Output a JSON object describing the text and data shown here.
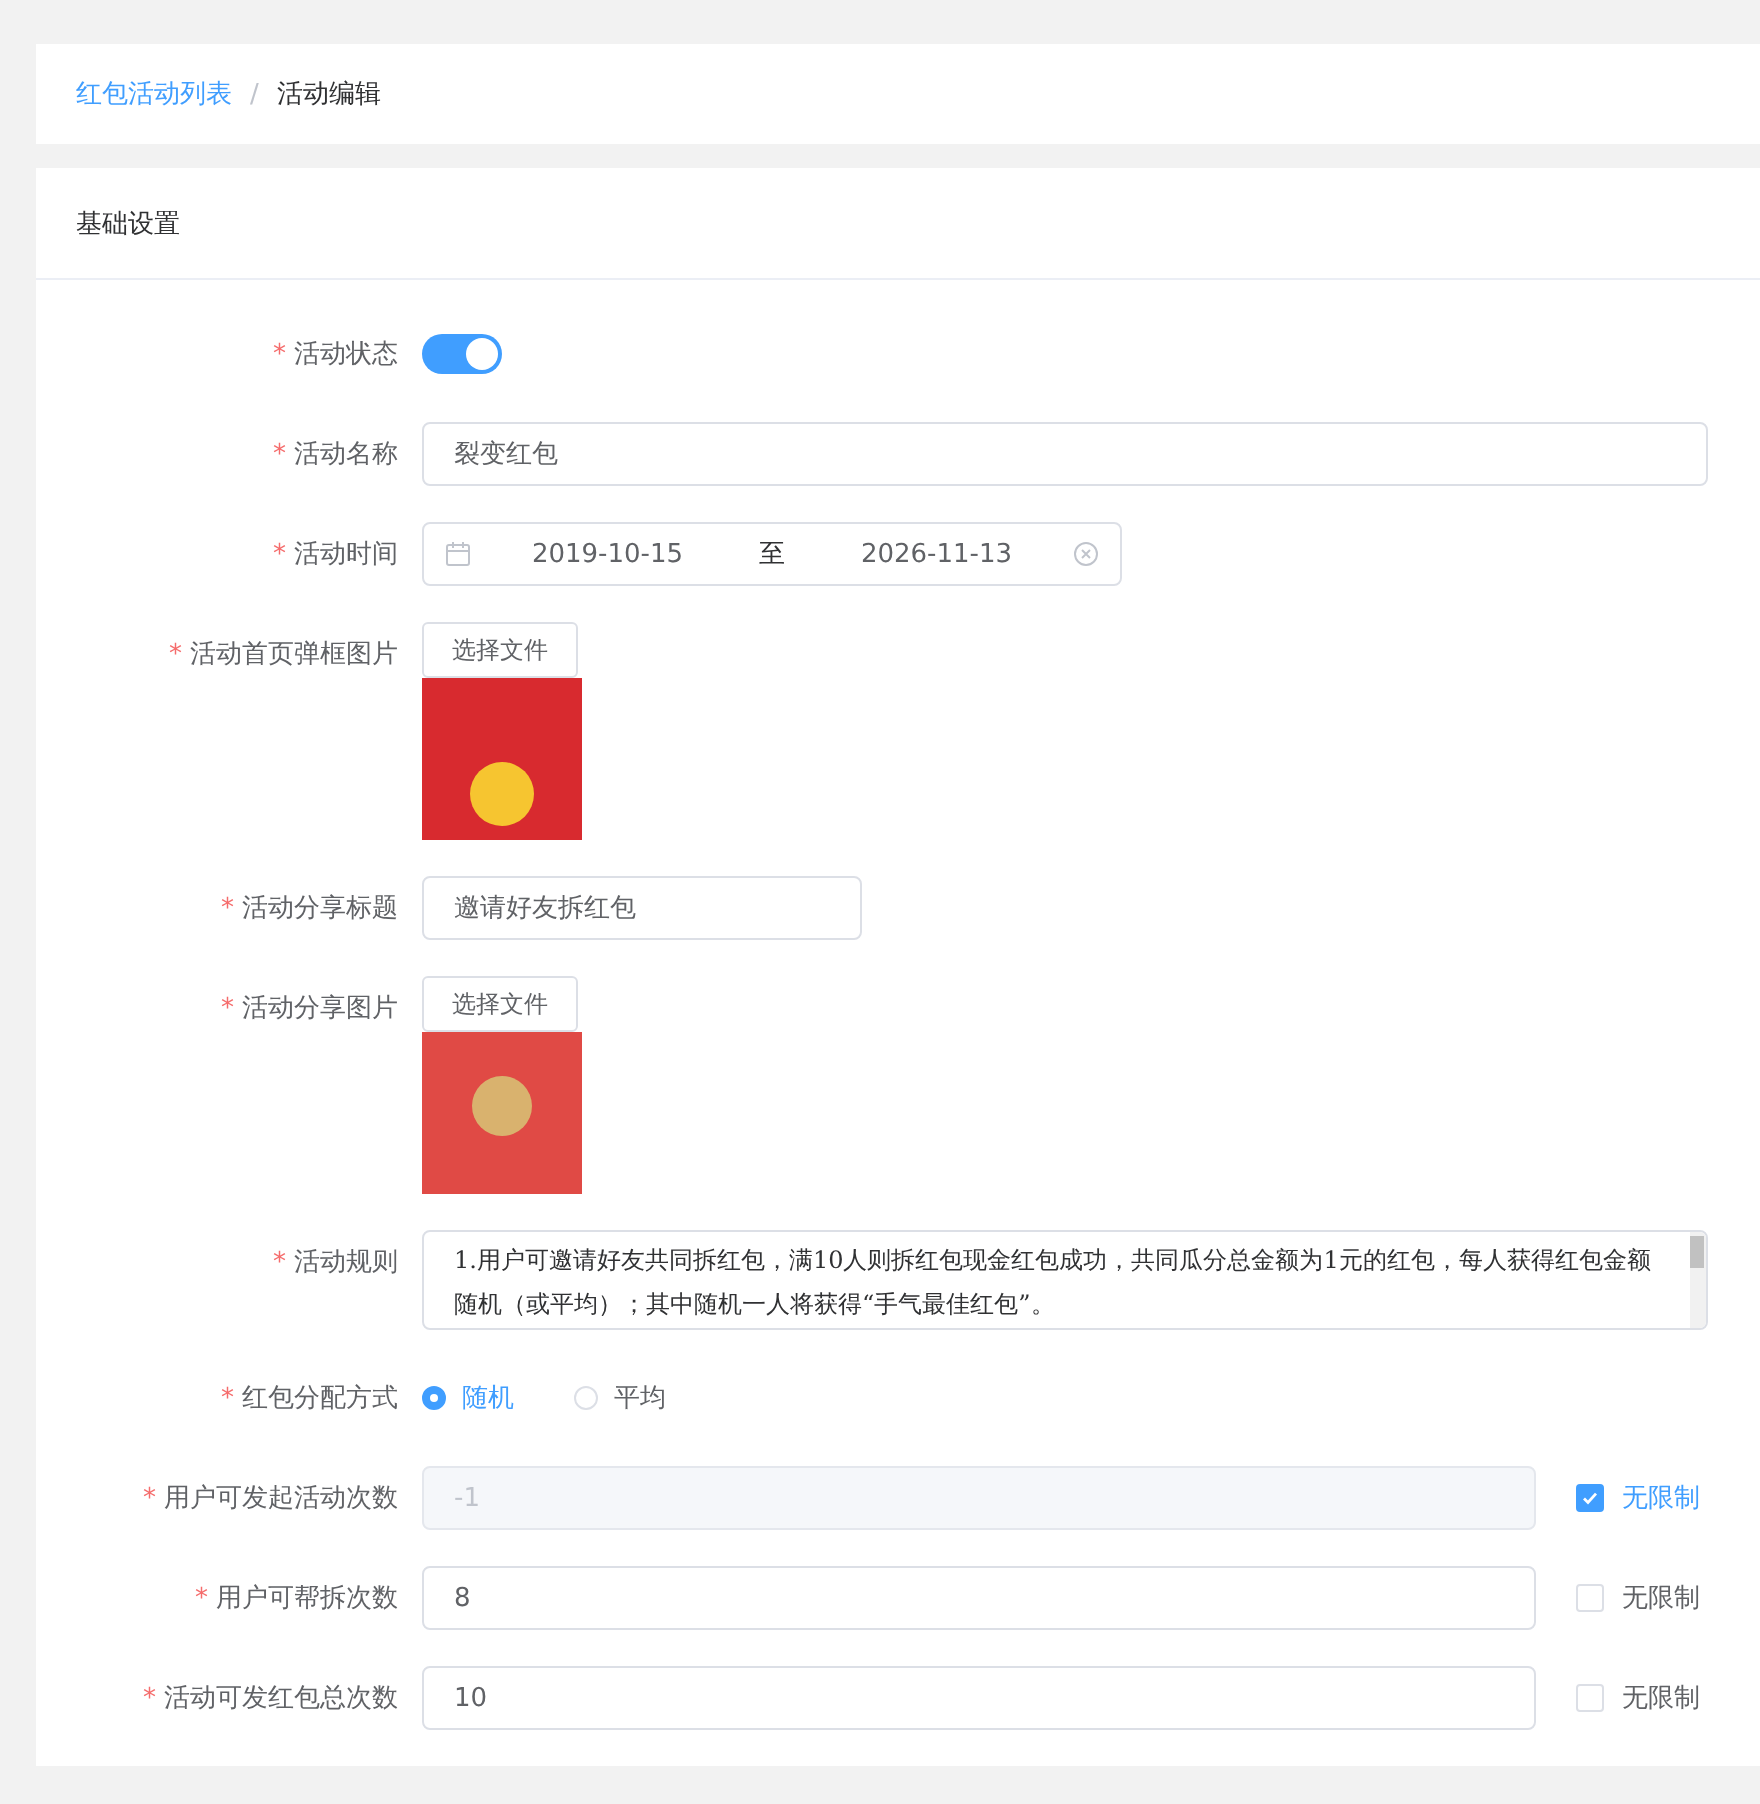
{
  "breadcrumb": {
    "parent": "红包活动列表",
    "separator": "/",
    "current": "活动编辑"
  },
  "section_title": "基础设置",
  "fields": [
    {
      "kind": "switch",
      "label": "活动状态",
      "required_mark": "*",
      "on": true
    },
    {
      "kind": "text",
      "label": "活动名称",
      "required_mark": "*",
      "value": "裂变红包"
    },
    {
      "kind": "daterange",
      "label": "活动时间",
      "required_mark": "*",
      "start": "2019-10-15",
      "separator": "至",
      "end": "2026-11-13"
    },
    {
      "kind": "upload",
      "label": "活动首页弹框图片",
      "required_mark": "*",
      "button": "选择文件"
    },
    {
      "kind": "short_text",
      "label": "活动分享标题",
      "required_mark": "*",
      "value": "邀请好友拆红包"
    },
    {
      "kind": "upload",
      "label": "活动分享图片",
      "required_mark": "*",
      "button": "选择文件"
    },
    {
      "kind": "textarea",
      "label": "活动规则",
      "required_mark": "*",
      "value": "1.用户可邀请好友共同拆红包，满10人则拆红包现金红包成功，共同瓜分总金额为1元的红包，每人获得红包金额随机（或平均）；其中随机一人将获得“手气最佳红包”。"
    },
    {
      "kind": "radio",
      "label": "红包分配方式",
      "required_mark": "*",
      "options": [
        {
          "label": "随机",
          "selected": true
        },
        {
          "label": "平均",
          "selected": false
        }
      ]
    },
    {
      "kind": "limit",
      "label": "用户可发起活动次数",
      "required_mark": "*",
      "value": "-1",
      "disabled": true,
      "checkbox": {
        "label": "无限制",
        "checked": true
      }
    },
    {
      "kind": "limit",
      "label": "用户可帮拆次数",
      "required_mark": "*",
      "value": "8",
      "disabled": false,
      "checkbox": {
        "label": "无限制",
        "checked": false
      }
    },
    {
      "kind": "limit",
      "label": "活动可发红包总次数",
      "required_mark": "*",
      "value": "10",
      "disabled": false,
      "checkbox": {
        "label": "无限制",
        "checked": false
      }
    }
  ]
}
